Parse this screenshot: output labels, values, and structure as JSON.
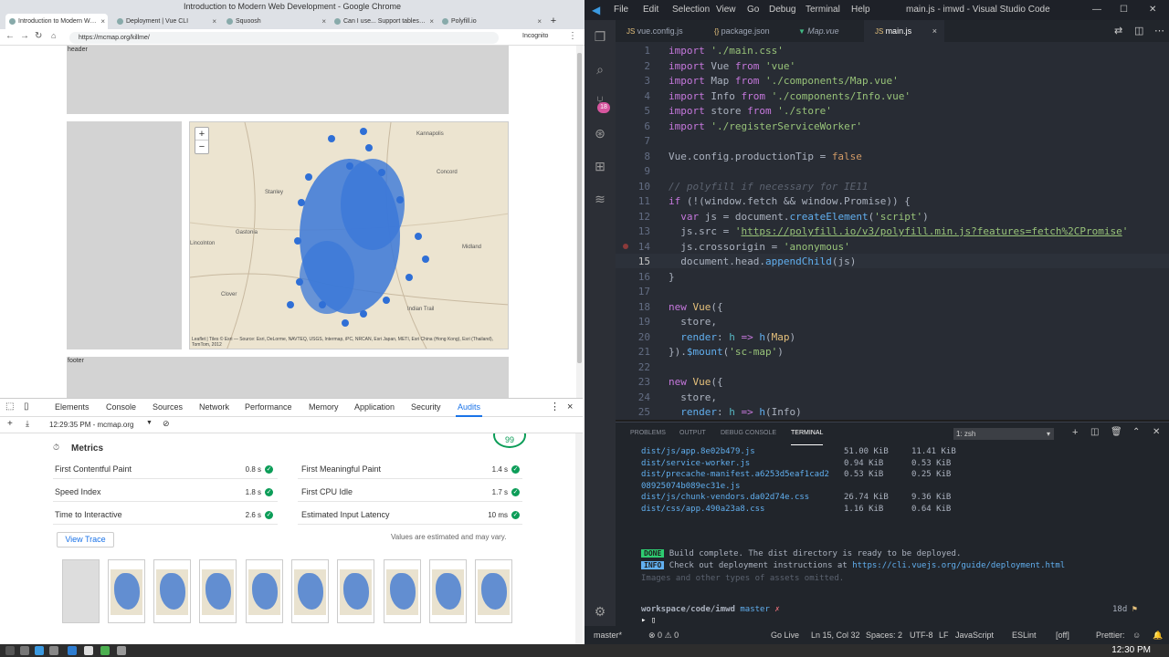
{
  "chrome": {
    "window_title": "Introduction to Modern Web Development - Google Chrome",
    "tabs": [
      {
        "label": "Introduction to Modern Web...",
        "active": true
      },
      {
        "label": "Deployment | Vue CLI"
      },
      {
        "label": "Squoosh"
      },
      {
        "label": "Can I use... Support tables fo..."
      },
      {
        "label": "Polyfill.io"
      }
    ],
    "url": "https://mcmap.org/killme/",
    "incognito_label": "Incognito",
    "page": {
      "header_label": "header",
      "footer_label": "footer",
      "map": {
        "zoom_in": "+",
        "zoom_out": "−",
        "cities": [
          "Kannapolis",
          "Concord",
          "Stanley",
          "Gastonia",
          "Midland",
          "Clover",
          "Indian Trail",
          "Lincolnton"
        ],
        "attribution": "Leaflet | Tiles © Esri — Source: Esri, DeLorme, NAVTEQ, USGS, Intermap, iPC, NRCAN, Esri Japan, METI, Esri China (Hong Kong), Esri (Thailand), TomTom, 2012"
      }
    },
    "devtools": {
      "tabs": [
        "Elements",
        "Console",
        "Sources",
        "Network",
        "Performance",
        "Memory",
        "Application",
        "Security",
        "Audits"
      ],
      "active_tab": "Audits",
      "report_label": "12:29:35 PM - mcmap.org",
      "score": "99",
      "metrics_title": "Metrics",
      "metrics": [
        {
          "label": "First Contentful Paint",
          "value": "0.8 s"
        },
        {
          "label": "First Meaningful Paint",
          "value": "1.4 s"
        },
        {
          "label": "Speed Index",
          "value": "1.8 s"
        },
        {
          "label": "First CPU Idle",
          "value": "1.7 s"
        },
        {
          "label": "Time to Interactive",
          "value": "2.6 s"
        },
        {
          "label": "Estimated Input Latency",
          "value": "10 ms"
        }
      ],
      "view_trace": "View Trace",
      "estimate_note": "Values are estimated and may vary."
    }
  },
  "vscode": {
    "window_title": "main.js - imwd - Visual Studio Code",
    "menu": [
      "File",
      "Edit",
      "Selection",
      "View",
      "Go",
      "Debug",
      "Terminal",
      "Help"
    ],
    "scm_badge": "18",
    "tabs": [
      {
        "label": "vue.config.js"
      },
      {
        "label": "package.json"
      },
      {
        "label": "Map.vue"
      },
      {
        "label": "main.js",
        "active": true
      }
    ],
    "code_lines": [
      "1",
      "2",
      "3",
      "4",
      "5",
      "6",
      "7",
      "8",
      "9",
      "10",
      "11",
      "12",
      "13",
      "14",
      "15",
      "16",
      "17",
      "18",
      "19",
      "20",
      "21",
      "22",
      "23",
      "24",
      "25"
    ],
    "panel_tabs": [
      "PROBLEMS",
      "OUTPUT",
      "DEBUG CONSOLE",
      "TERMINAL"
    ],
    "active_panel": "TERMINAL",
    "terminal_select": "1: zsh",
    "terminal_files": [
      {
        "name": "dist/js/app.8e02b479.js",
        "size": "51.00 KiB",
        "gzip": "11.41 KiB"
      },
      {
        "name": "dist/service-worker.js",
        "size": "0.94 KiB",
        "gzip": "0.53 KiB"
      },
      {
        "name": "dist/precache-manifest.a6253d5eaf1cad2",
        "size": "0.53 KiB",
        "gzip": "0.25 KiB"
      },
      {
        "name": "08925074b089ec31e.js",
        "size": "",
        "gzip": ""
      },
      {
        "name": "dist/js/chunk-vendors.da02d74e.css",
        "size": "26.74 KiB",
        "gzip": "9.36 KiB"
      },
      {
        "name": "dist/css/app.490a23a8.css",
        "size": "1.16 KiB",
        "gzip": "0.64 KiB"
      }
    ],
    "terminal_note": "Images and other types of assets omitted.",
    "done_badge": "DONE",
    "done_text": "Build complete. The dist directory is ready to be deployed.",
    "info_badge": "INFO",
    "info_text": "Check out deployment instructions at",
    "info_link": "https://cli.vuejs.org/guide/deployment.html",
    "prompt_path": "workspace/code/imwd",
    "prompt_branch": "master",
    "prompt_mark": "✗",
    "prompt_time": "18d",
    "status": {
      "branch": "master*",
      "errors": "0",
      "warnings": "0",
      "golive": "Go Live",
      "position": "Ln 15, Col 32",
      "spaces": "Spaces: 2",
      "encoding": "UTF-8",
      "eol": "LF",
      "language": "JavaScript",
      "eslint": "ESLint",
      "off": "[off]",
      "prettier": "Prettier:"
    }
  },
  "taskbar": {
    "clock": "12:30 PM"
  },
  "colors": {
    "accent": "#1a73e8",
    "pass": "#0c9d58",
    "vs_bg": "#282c34"
  }
}
